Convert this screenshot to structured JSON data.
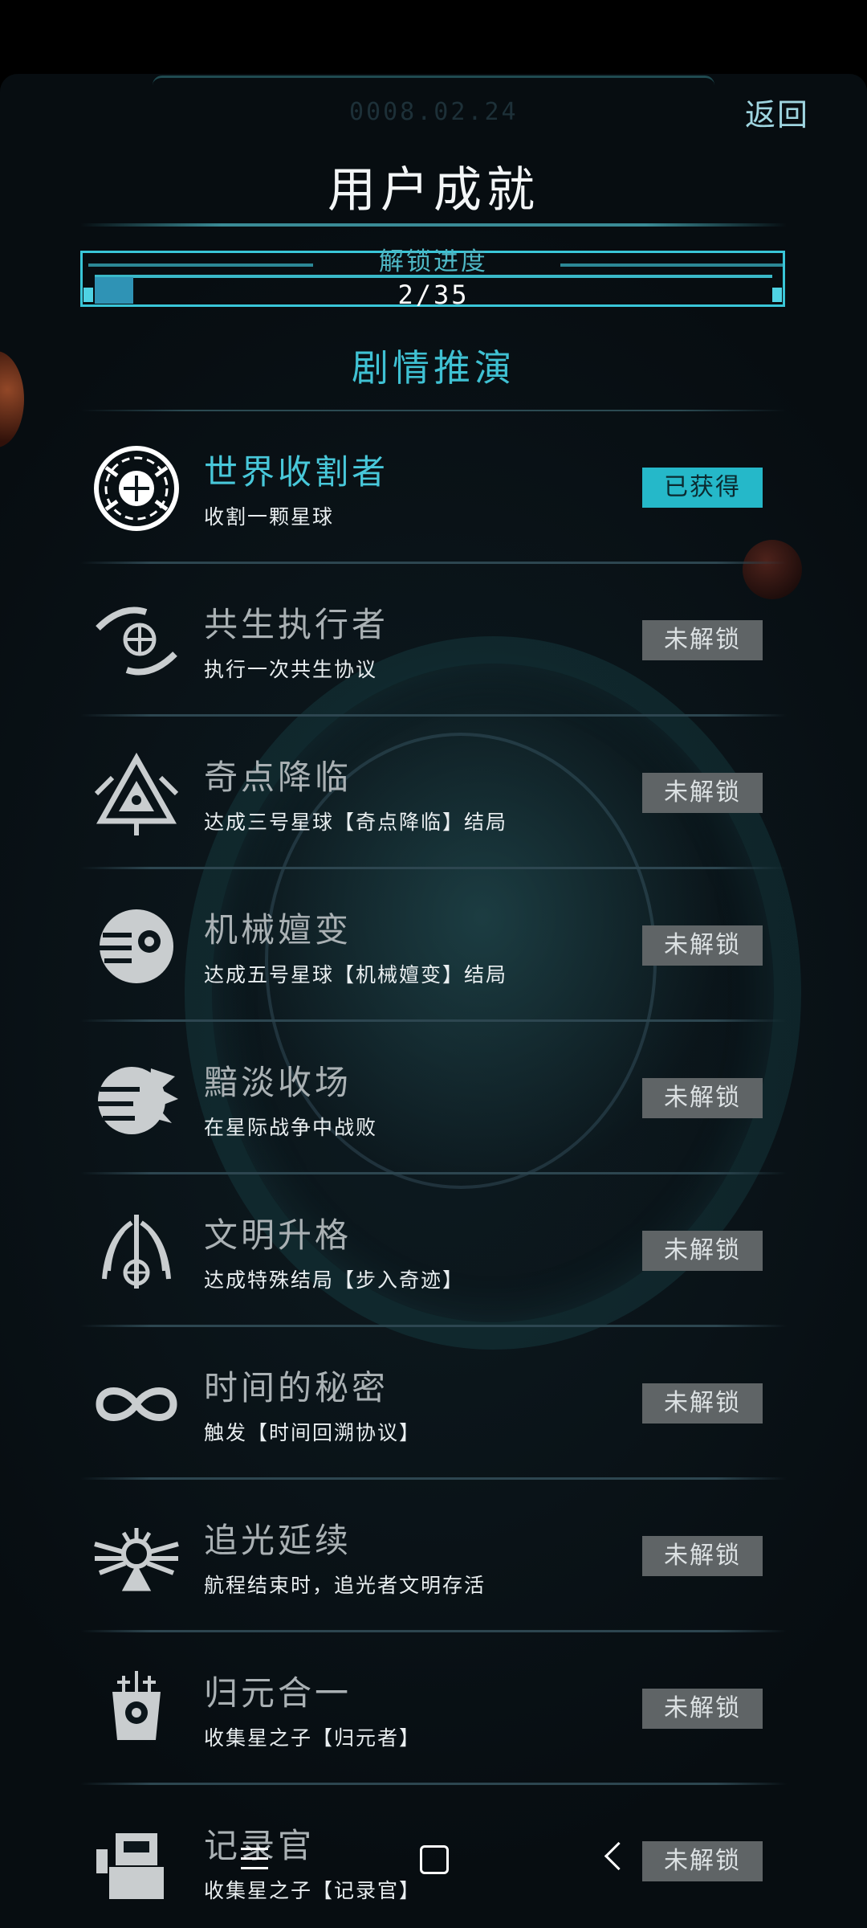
{
  "header": {
    "date": "0008.02.24",
    "back_label": "返回",
    "title": "用户成就"
  },
  "progress": {
    "label": "解锁进度",
    "text": "2/35",
    "unlocked": 2,
    "total": 35
  },
  "section_title": "剧情推演",
  "achievements": [
    {
      "name": "世界收割者",
      "desc": "收割一颗星球",
      "status": "已获得",
      "icon": "harvester-globe-icon",
      "unlocked": true
    },
    {
      "name": "共生执行者",
      "desc": "执行一次共生协议",
      "status": "未解锁",
      "icon": "symbiosis-hands-globe-icon",
      "unlocked": false
    },
    {
      "name": "奇点降临",
      "desc": "达成三号星球【奇点降临】结局",
      "status": "未解锁",
      "icon": "singularity-triangle-icon",
      "unlocked": false
    },
    {
      "name": "机械嬗变",
      "desc": "达成五号星球【机械嬗变】结局",
      "status": "未解锁",
      "icon": "mechanical-planet-icon",
      "unlocked": false
    },
    {
      "name": "黯淡收场",
      "desc": "在星际战争中战败",
      "status": "未解锁",
      "icon": "shattered-planet-icon",
      "unlocked": false
    },
    {
      "name": "文明升格",
      "desc": "达成特殊结局【步入奇迹】",
      "status": "未解锁",
      "icon": "winged-emblem-icon",
      "unlocked": false
    },
    {
      "name": "时间的秘密",
      "desc": "触发【时间回溯协议】",
      "status": "未解锁",
      "icon": "infinity-icon",
      "unlocked": false
    },
    {
      "name": "追光延续",
      "desc": "航程结束时，追光者文明存活",
      "status": "未解锁",
      "icon": "winged-sun-icon",
      "unlocked": false
    },
    {
      "name": "归元合一",
      "desc": "收集星之子【归元者】",
      "status": "未解锁",
      "icon": "robot-mask-icon",
      "unlocked": false
    },
    {
      "name": "记录官",
      "desc": "收集星之子【记录官】",
      "status": "未解锁",
      "icon": "recorder-robot-icon",
      "unlocked": false
    }
  ],
  "colors": {
    "accent": "#3fc1d3",
    "unlocked_badge": "#25b8c9",
    "locked_badge": "#5f6466",
    "background": "#0b151a"
  },
  "navbar": {
    "menu_icon": "menu-icon",
    "home_icon": "home-square-icon",
    "back_icon": "back-chevron-icon"
  }
}
